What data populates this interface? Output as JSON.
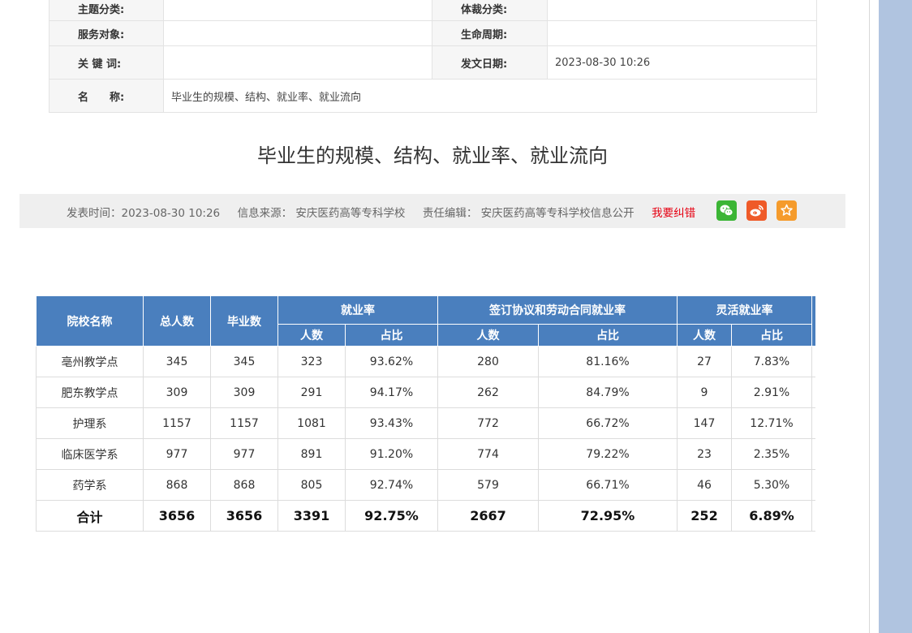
{
  "meta": {
    "topic_label": "主题分类:",
    "topic_value": "",
    "genre_label": "体裁分类:",
    "genre_value": "",
    "audience_label": "服务对象:",
    "audience_value": "",
    "lifecycle_label": "生命周期:",
    "lifecycle_value": "",
    "keywords_label": "关 键 词:",
    "keywords_value": "",
    "date_label": "发文日期:",
    "date_value": "2023-08-30 10:26",
    "name_label": "名　　称:",
    "name_value": "毕业生的规模、结构、就业率、就业流向"
  },
  "title": "毕业生的规模、结构、就业率、就业流向",
  "info": {
    "publish_time": "发表时间：2023-08-30 10:26",
    "source": "信息来源：  安庆医药高等专科学校",
    "editor": "责任编辑：  安庆医药高等专科学校信息公开",
    "correct_link": "我要纠错",
    "share_icons": [
      "wechat-icon",
      "weibo-icon",
      "favorite-star-icon"
    ],
    "colors": {
      "wechat": "#3bb535",
      "weibo": "#ef5a28",
      "favorite": "#f59b2c",
      "correct": "#e60012"
    }
  },
  "table": {
    "header_color": "#4a7fbe",
    "headers": {
      "school": "院校名称",
      "total": "总人数",
      "graduates": "毕业数",
      "employment_rate": "就业率",
      "contract_rate": "签订协议和劳动合同就业率",
      "flexible_rate": "灵活就业率",
      "count": "人数",
      "ratio": "占比"
    },
    "rows": [
      [
        "亳州教学点",
        "345",
        "345",
        "323",
        "93.62%",
        "280",
        "81.16%",
        "27",
        "7.83%"
      ],
      [
        "肥东教学点",
        "309",
        "309",
        "291",
        "94.17%",
        "262",
        "84.79%",
        "9",
        "2.91%"
      ],
      [
        "护理系",
        "1157",
        "1157",
        "1081",
        "93.43%",
        "772",
        "66.72%",
        "147",
        "12.71%"
      ],
      [
        "临床医学系",
        "977",
        "977",
        "891",
        "91.20%",
        "774",
        "79.22%",
        "23",
        "2.35%"
      ],
      [
        "药学系",
        "868",
        "868",
        "805",
        "92.74%",
        "579",
        "66.71%",
        "46",
        "5.30%"
      ]
    ],
    "total": [
      "合计",
      "3656",
      "3656",
      "3391",
      "92.75%",
      "2667",
      "72.95%",
      "252",
      "6.89%"
    ]
  }
}
